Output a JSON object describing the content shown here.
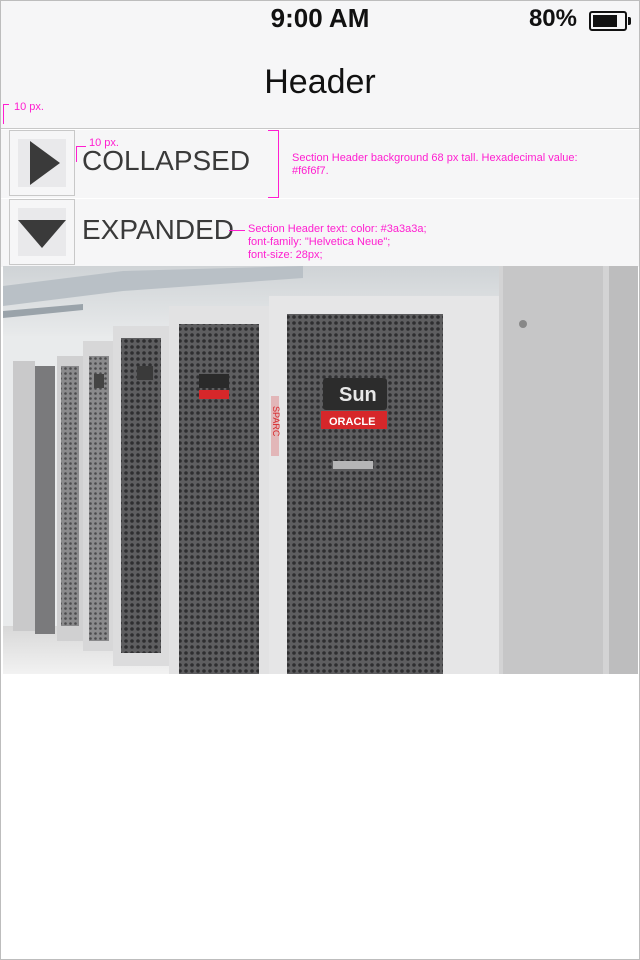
{
  "status_bar": {
    "time": "9:00 AM",
    "battery_percent": "80%",
    "battery_level": 0.8
  },
  "nav": {
    "title": "Header"
  },
  "sections": [
    {
      "label": "COLLAPSED",
      "state": "collapsed"
    },
    {
      "label": "EXPANDED",
      "state": "expanded"
    }
  ],
  "annotations": {
    "margin_note": "10 px.",
    "inner_margin_note": "10 px.",
    "background_note_line1": "Section Header background 68 px tall. Hexadecimal value:",
    "background_note_line2": "#f6f6f7.",
    "text_note_line1": "Section Header text: color: #3a3a3a;",
    "text_note_line2": "font-family: \"Helvetica Neue\";",
    "text_note_line3": "font-size: 28px;"
  },
  "photo": {
    "brand_text": "Sun",
    "logo_text": "ORACLE",
    "rack_label": "SPARC"
  },
  "colors": {
    "section_bg": "#f6f6f7",
    "section_text": "#3a3a3a",
    "annotation": "#ff1ed0",
    "oracle_red": "#d6272a"
  }
}
